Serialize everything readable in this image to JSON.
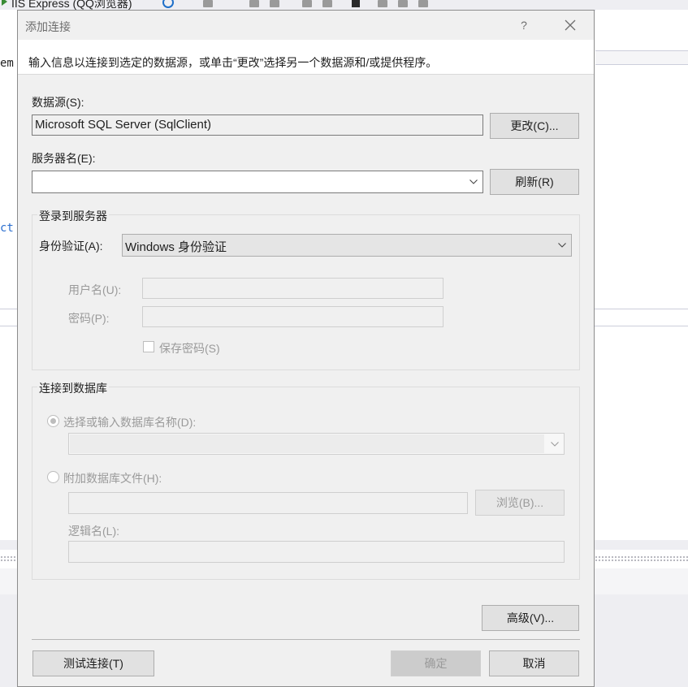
{
  "ide": {
    "toolbar_label": "IIS Express (QQ浏览器)",
    "code_fragment_1": "em",
    "code_fragment_2": "ct"
  },
  "dialog": {
    "title": "添加连接",
    "help_glyph": "?",
    "instruction": "输入信息以连接到选定的数据源，或单击“更改”选择另一个数据源和/或提供程序。",
    "datasource": {
      "label": "数据源(S):",
      "value": "Microsoft SQL Server (SqlClient)",
      "change_button": "更改(C)..."
    },
    "server": {
      "label": "服务器名(E):",
      "value": "",
      "refresh_button": "刷新(R)"
    },
    "login_group": {
      "title": "登录到服务器",
      "auth_label": "身份验证(A):",
      "auth_value": "Windows 身份验证",
      "username_label": "用户名(U):",
      "username_value": "",
      "password_label": "密码(P):",
      "password_value": "",
      "save_password_label": "保存密码(S)"
    },
    "db_group": {
      "title": "连接到数据库",
      "select_db_label": "选择或输入数据库名称(D):",
      "select_db_value": "",
      "attach_label": "附加数据库文件(H):",
      "attach_value": "",
      "browse_button": "浏览(B)...",
      "logical_name_label": "逻辑名(L):",
      "logical_name_value": ""
    },
    "advanced_button": "高级(V)...",
    "test_button": "测试连接(T)",
    "ok_button": "确定",
    "cancel_button": "取消"
  },
  "colors": {
    "dialog_bg": "#f0f0f0",
    "disabled_text": "#9a9a9a",
    "border": "#7a7a7a"
  }
}
